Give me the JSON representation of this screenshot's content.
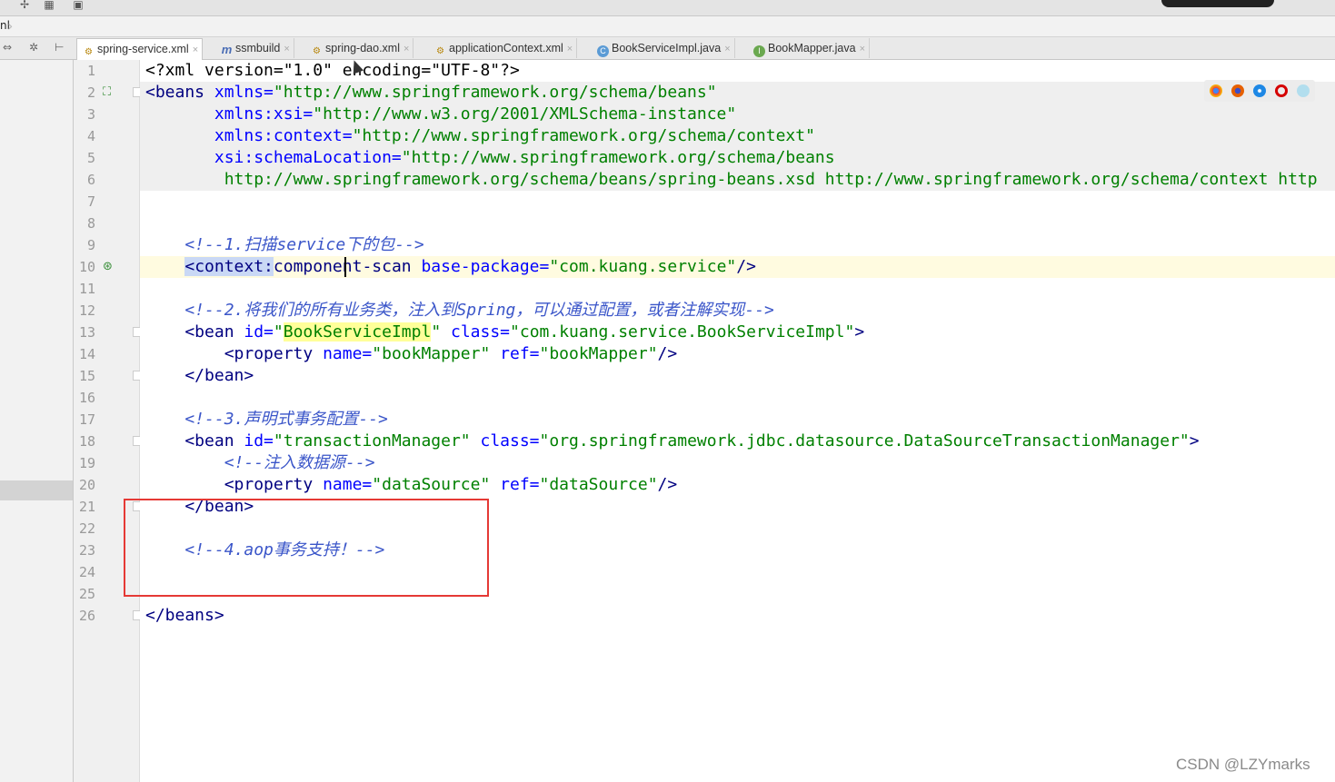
{
  "navbar": {
    "crumb": "nl"
  },
  "tabs": [
    {
      "label": "spring-service.xml",
      "icon": "xml-file-icon",
      "active": true
    },
    {
      "label": "ssmbuild",
      "icon": "module-icon",
      "active": false
    },
    {
      "label": "spring-dao.xml",
      "icon": "xml-file-icon",
      "active": false
    },
    {
      "label": "applicationContext.xml",
      "icon": "xml-file-icon",
      "active": false
    },
    {
      "label": "BookServiceImpl.java",
      "icon": "class-icon",
      "active": false
    },
    {
      "label": "BookMapper.java",
      "icon": "interface-icon",
      "active": false
    }
  ],
  "editor": {
    "line_numbers": [
      "1",
      "2",
      "3",
      "4",
      "5",
      "6",
      "7",
      "8",
      "9",
      "10",
      "11",
      "12",
      "13",
      "14",
      "15",
      "16",
      "17",
      "18",
      "19",
      "20",
      "21",
      "22",
      "23",
      "24",
      "25",
      "26"
    ],
    "lines": {
      "l1": {
        "a": "<?xml version=\"1.0\" encoding=\"UTF-8\"?>"
      },
      "l2": {
        "a": "<beans",
        "b": " xmlns=",
        "c": "\"http://www.springframework.org/schema/beans\""
      },
      "l3": {
        "a": "       xmlns:xsi=",
        "b": "\"http://www.w3.org/2001/XMLSchema-instance\""
      },
      "l4": {
        "a": "       xmlns:context=",
        "b": "\"http://www.springframework.org/schema/context\""
      },
      "l5": {
        "a": "       xsi:schemaLocation=",
        "b": "\"http://www.springframework.org/schema/beans"
      },
      "l6": {
        "a": "        http://www.springframework.org/schema/beans/spring-beans.xsd http://www.springframework.org/schema/context http"
      },
      "l9": {
        "a": "    <!--1.扫描service下的包-->"
      },
      "l10": {
        "a": "    ",
        "b": "<context:",
        "c": "component-scan",
        "d": " base-package=",
        "e": "\"com.kuang.service\"",
        "f": "/>"
      },
      "l12": {
        "a": "    <!--2.将我们的所有业务类，注入到Spring，可以通过配置，或者注解实现-->"
      },
      "l13": {
        "a": "    <bean",
        "b": " id=",
        "c": "\"",
        "d": "BookServiceImpl",
        "e": "\"",
        "f": " class=",
        "g": "\"com.kuang.service.BookServiceImpl\"",
        "h": ">"
      },
      "l14": {
        "a": "        <property",
        "b": " name=",
        "c": "\"bookMapper\"",
        "d": " ref=",
        "e": "\"bookMapper\"",
        "f": "/>"
      },
      "l15": {
        "a": "    </bean>"
      },
      "l17": {
        "a": "    <!--3.声明式事务配置-->"
      },
      "l18": {
        "a": "    <bean",
        "b": " id=",
        "c": "\"transactionManager\"",
        "d": " class=",
        "e": "\"org.springframework.jdbc.datasource.DataSourceTransactionManager\"",
        "f": ">"
      },
      "l19": {
        "a": "        <!--注入数据源-->"
      },
      "l20": {
        "a": "        <property",
        "b": " name=",
        "c": "\"dataSource\"",
        "d": " ref=",
        "e": "\"dataSource\"",
        "f": "/>"
      },
      "l21": {
        "a": "    </bean>"
      },
      "l23": {
        "a": "    <!--4.aop事务支持！-->"
      },
      "l26": {
        "a": "</beans>"
      }
    }
  },
  "browser_icons": [
    "chrome-icon",
    "firefox-icon",
    "safari-icon",
    "opera-icon",
    "ie-icon"
  ],
  "watermark": "CSDN @LZYmarks",
  "colors": {
    "tag": "#000080",
    "attr": "#0000ff",
    "value": "#008000",
    "comment": "#3b56c9",
    "highlight_box": "#e53935"
  }
}
